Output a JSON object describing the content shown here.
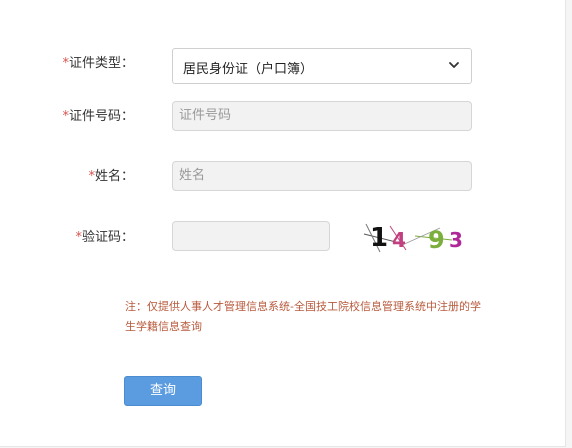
{
  "form": {
    "required_mark": "*",
    "id_type": {
      "label": "证件类型：",
      "selected": "居民身份证（户口簿）"
    },
    "id_number": {
      "label": "证件号码：",
      "placeholder": "证件号码"
    },
    "name": {
      "label": "姓名：",
      "placeholder": "姓名"
    },
    "captcha": {
      "label": "验证码：",
      "value": "",
      "image_chars": [
        "1",
        "4",
        "9",
        "3"
      ]
    },
    "note": "注：仅提供人事人才管理信息系统-全国技工院校信息管理系统中注册的学生学籍信息查询",
    "submit_label": "查询"
  },
  "colors": {
    "required": "#d9534f",
    "note": "#b85a3c",
    "button": "#5b9be0",
    "captcha_chars": [
      "#111111",
      "#c2407f",
      "#7cae3c",
      "#b0279a"
    ]
  }
}
